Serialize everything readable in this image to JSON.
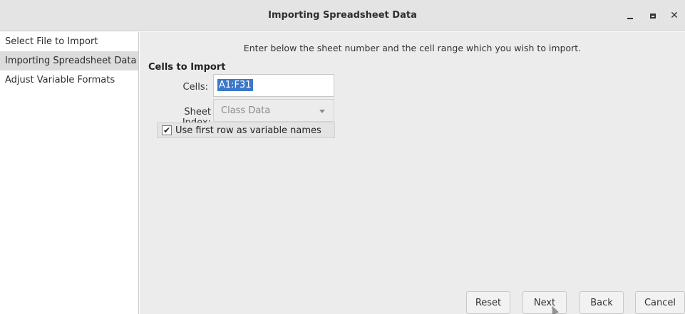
{
  "window": {
    "title": "Importing Spreadsheet Data",
    "minimize_icon": "minimize-icon",
    "maximize_icon": "maximize-icon",
    "close_glyph": "✕"
  },
  "sidebar": {
    "items": [
      {
        "label": "Select File to Import",
        "active": false
      },
      {
        "label": "Importing Spreadsheet Data",
        "active": true
      },
      {
        "label": "Adjust Variable Formats",
        "active": false
      }
    ]
  },
  "main": {
    "instruction": "Enter below the sheet number and the cell range which you wish to import.",
    "section_title": "Cells to Import",
    "cells": {
      "label": "Cells:",
      "value": "A1:F31"
    },
    "sheet": {
      "label": "Sheet Index:",
      "value": "Class Data"
    },
    "first_row": {
      "label": "Use first row as variable names",
      "checked": true,
      "check_glyph": "✔"
    }
  },
  "buttons": {
    "reset": "Reset",
    "next": "Next",
    "back": "Back",
    "cancel": "Cancel"
  },
  "colors": {
    "selection": "#3d78c9",
    "panel": "#ececec",
    "active_sidebar": "#dcdcdc"
  }
}
